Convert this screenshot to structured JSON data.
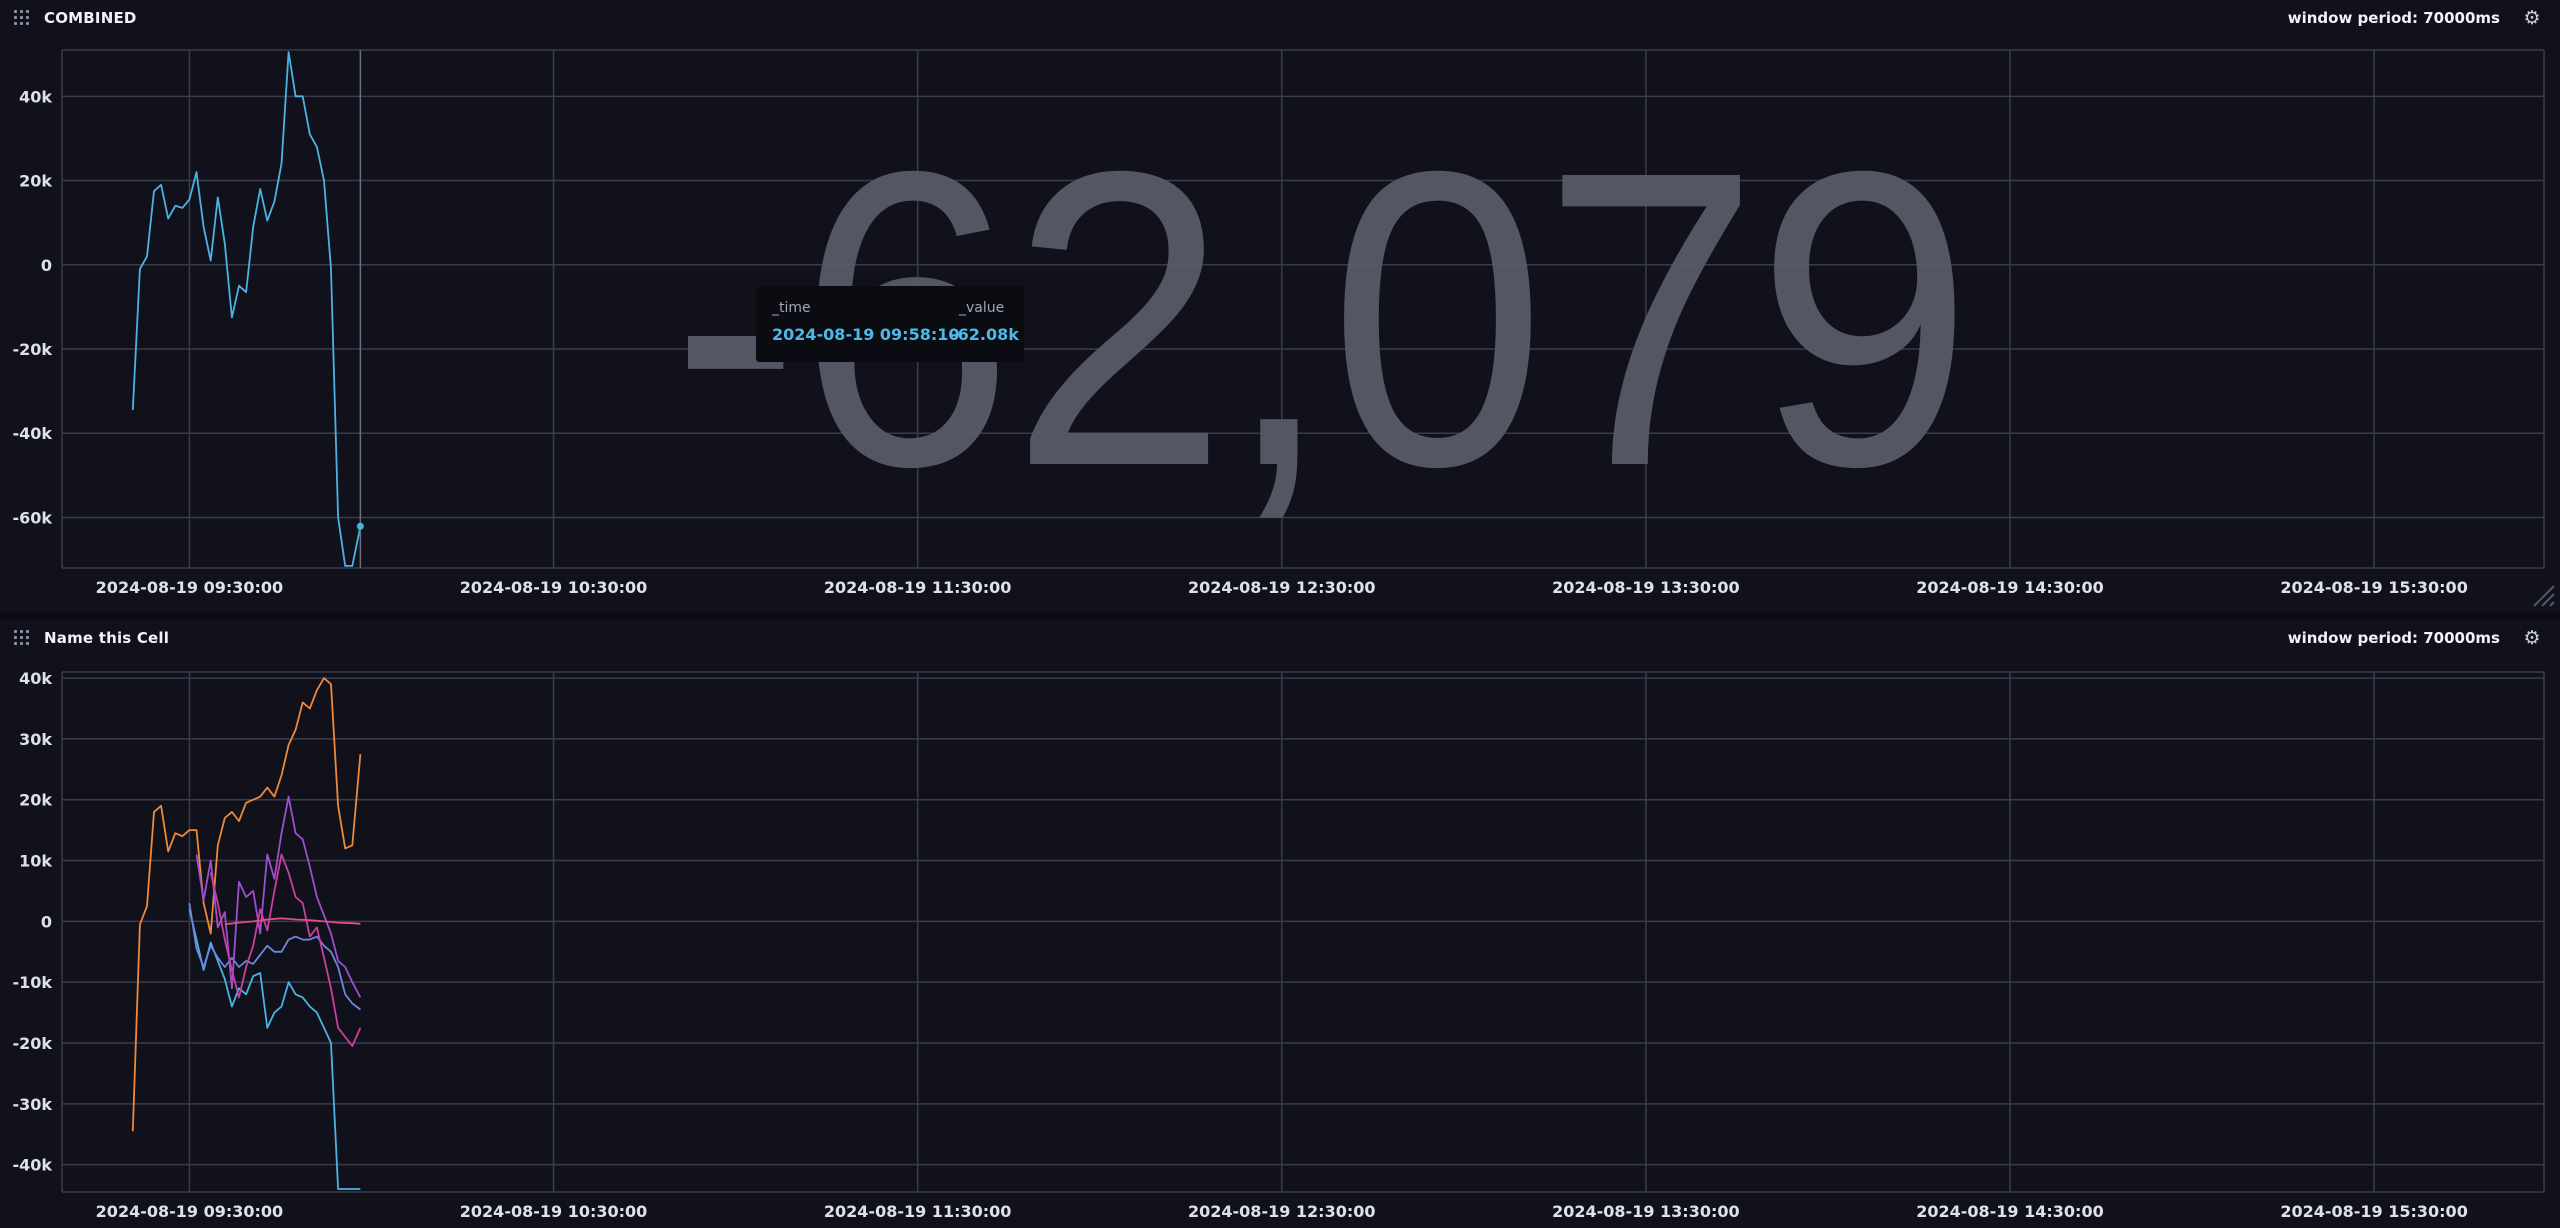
{
  "cells": [
    {
      "title": "COMBINED",
      "window_period": "window period: 70000ms",
      "big_value": "-62,079",
      "tooltip": {
        "time_header": "_time",
        "value_header": "_value",
        "time": "2024-08-19 09:58:10",
        "value": "-62.08k"
      }
    },
    {
      "title": "Name this Cell",
      "window_period": "window period: 70000ms"
    }
  ],
  "colors": {
    "background": "#10111b",
    "grid": "#3a3c4c",
    "big_value": "#5a5c6a",
    "series_blue": "#4ab3e4",
    "series_orange": "#f0883a",
    "series_purple": "#9e4fcf",
    "series_magenta": "#c8409c",
    "series_pink": "#e0507a",
    "series_indigo": "#6d86e0"
  },
  "chart_data": [
    {
      "type": "line",
      "title": "COMBINED",
      "xlabel": "",
      "ylabel": "",
      "x_ticks": [
        "2024-08-19 09:30:00",
        "2024-08-19 10:30:00",
        "2024-08-19 11:30:00",
        "2024-08-19 12:30:00",
        "2024-08-19 13:30:00",
        "2024-08-19 14:30:00",
        "2024-08-19 15:30:00"
      ],
      "y_ticks": [
        "40k",
        "20k",
        "0",
        "-20k",
        "-40k",
        "-60k"
      ],
      "xlim": [
        "2024-08-19 09:09:00",
        "2024-08-19 15:58:00"
      ],
      "ylim": [
        -72000,
        51000
      ],
      "grid": true,
      "series": [
        {
          "color": "#4ab3e4",
          "x": [
            "2024-08-19 09:20:40",
            "2024-08-19 09:21:50",
            "2024-08-19 09:23:00",
            "2024-08-19 09:24:10",
            "2024-08-19 09:25:20",
            "2024-08-19 09:26:30",
            "2024-08-19 09:27:40",
            "2024-08-19 09:28:50",
            "2024-08-19 09:30:00",
            "2024-08-19 09:31:10",
            "2024-08-19 09:32:20",
            "2024-08-19 09:33:30",
            "2024-08-19 09:34:40",
            "2024-08-19 09:35:50",
            "2024-08-19 09:37:00",
            "2024-08-19 09:38:10",
            "2024-08-19 09:39:20",
            "2024-08-19 09:40:30",
            "2024-08-19 09:41:40",
            "2024-08-19 09:42:50",
            "2024-08-19 09:44:00",
            "2024-08-19 09:45:10",
            "2024-08-19 09:46:20",
            "2024-08-19 09:47:30",
            "2024-08-19 09:48:40",
            "2024-08-19 09:49:50",
            "2024-08-19 09:51:00",
            "2024-08-19 09:52:10",
            "2024-08-19 09:53:20",
            "2024-08-19 09:54:30",
            "2024-08-19 09:55:40",
            "2024-08-19 09:56:50",
            "2024-08-19 09:58:10"
          ],
          "values": [
            -34500,
            -1000,
            2000,
            17500,
            19000,
            11000,
            14000,
            13500,
            15500,
            22000,
            9000,
            1000,
            16000,
            5000,
            -12500,
            -5000,
            -6500,
            9000,
            18000,
            10500,
            15000,
            24000,
            50500,
            40000,
            40000,
            31000,
            28000,
            20000,
            -1000,
            -60000,
            -71500,
            -71500,
            -62079
          ]
        }
      ]
    },
    {
      "type": "line",
      "title": "Name this Cell",
      "xlabel": "",
      "ylabel": "",
      "x_ticks": [
        "2024-08-19 09:30:00",
        "2024-08-19 10:30:00",
        "2024-08-19 11:30:00",
        "2024-08-19 12:30:00",
        "2024-08-19 13:30:00",
        "2024-08-19 14:30:00",
        "2024-08-19 15:30:00"
      ],
      "y_ticks": [
        "40k",
        "30k",
        "20k",
        "10k",
        "0",
        "-10k",
        "-20k",
        "-30k",
        "-40k"
      ],
      "xlim": [
        "2024-08-19 09:09:00",
        "2024-08-19 15:58:00"
      ],
      "ylim": [
        -44500,
        41000
      ],
      "grid": true,
      "series": [
        {
          "color": "#f0883a",
          "x": [
            "2024-08-19 09:20:40",
            "2024-08-19 09:21:50",
            "2024-08-19 09:23:00",
            "2024-08-19 09:24:10",
            "2024-08-19 09:25:20",
            "2024-08-19 09:26:30",
            "2024-08-19 09:27:40",
            "2024-08-19 09:28:50",
            "2024-08-19 09:30:00",
            "2024-08-19 09:31:10",
            "2024-08-19 09:32:20",
            "2024-08-19 09:33:30",
            "2024-08-19 09:34:40",
            "2024-08-19 09:35:50",
            "2024-08-19 09:37:00",
            "2024-08-19 09:38:10",
            "2024-08-19 09:39:20",
            "2024-08-19 09:40:30",
            "2024-08-19 09:41:40",
            "2024-08-19 09:42:50",
            "2024-08-19 09:44:00",
            "2024-08-19 09:45:10",
            "2024-08-19 09:46:20",
            "2024-08-19 09:47:30",
            "2024-08-19 09:48:40",
            "2024-08-19 09:49:50",
            "2024-08-19 09:51:00",
            "2024-08-19 09:52:10",
            "2024-08-19 09:53:20",
            "2024-08-19 09:54:30",
            "2024-08-19 09:55:40",
            "2024-08-19 09:56:50",
            "2024-08-19 09:58:10"
          ],
          "values": [
            -34500,
            -500,
            2500,
            18000,
            19000,
            11500,
            14500,
            14000,
            15000,
            15000,
            3000,
            -2000,
            12500,
            17000,
            18000,
            16500,
            19500,
            20000,
            20500,
            22000,
            20500,
            24000,
            29000,
            31500,
            36000,
            35000,
            38000,
            40000,
            39000,
            19000,
            12000,
            12500,
            27500
          ]
        },
        {
          "color": "#4ab3e4",
          "x": [
            "2024-08-19 09:30:00",
            "2024-08-19 09:31:10",
            "2024-08-19 09:32:20",
            "2024-08-19 09:33:30",
            "2024-08-19 09:34:40",
            "2024-08-19 09:35:50",
            "2024-08-19 09:37:00",
            "2024-08-19 09:38:10",
            "2024-08-19 09:39:20",
            "2024-08-19 09:40:30",
            "2024-08-19 09:41:40",
            "2024-08-19 09:42:50",
            "2024-08-19 09:44:00",
            "2024-08-19 09:45:10",
            "2024-08-19 09:46:20",
            "2024-08-19 09:47:30",
            "2024-08-19 09:48:40",
            "2024-08-19 09:49:50",
            "2024-08-19 09:51:00",
            "2024-08-19 09:52:10",
            "2024-08-19 09:53:20",
            "2024-08-19 09:54:30",
            "2024-08-19 09:55:40",
            "2024-08-19 09:56:50",
            "2024-08-19 09:58:10"
          ],
          "values": [
            2000,
            -3000,
            -8000,
            -3500,
            -6500,
            -9500,
            -14000,
            -11000,
            -12000,
            -9000,
            -8500,
            -17500,
            -15000,
            -14000,
            -10000,
            -12000,
            -12500,
            -14000,
            -15000,
            -17500,
            -20000,
            -44000,
            -44000,
            -44000,
            -44000
          ]
        },
        {
          "color": "#6d86e0",
          "x": [
            "2024-08-19 09:30:00",
            "2024-08-19 09:31:10",
            "2024-08-19 09:32:20",
            "2024-08-19 09:33:30",
            "2024-08-19 09:34:40",
            "2024-08-19 09:35:50",
            "2024-08-19 09:37:00",
            "2024-08-19 09:38:10",
            "2024-08-19 09:39:20",
            "2024-08-19 09:40:30",
            "2024-08-19 09:41:40",
            "2024-08-19 09:42:50",
            "2024-08-19 09:44:00",
            "2024-08-19 09:45:10",
            "2024-08-19 09:46:20",
            "2024-08-19 09:47:30",
            "2024-08-19 09:48:40",
            "2024-08-19 09:49:50",
            "2024-08-19 09:51:00",
            "2024-08-19 09:52:10",
            "2024-08-19 09:53:20",
            "2024-08-19 09:54:30",
            "2024-08-19 09:55:40",
            "2024-08-19 09:56:50",
            "2024-08-19 09:58:10"
          ],
          "values": [
            3000,
            -4500,
            -7500,
            -4000,
            -6000,
            -7500,
            -6000,
            -7500,
            -6500,
            -7000,
            -5500,
            -4000,
            -5000,
            -5000,
            -3000,
            -2500,
            -3000,
            -3000,
            -2500,
            -4000,
            -5000,
            -7500,
            -12000,
            -13500,
            -14500
          ]
        },
        {
          "color": "#9e4fcf",
          "x": [
            "2024-08-19 09:31:10",
            "2024-08-19 09:32:20",
            "2024-08-19 09:33:30",
            "2024-08-19 09:34:40",
            "2024-08-19 09:35:50",
            "2024-08-19 09:37:00",
            "2024-08-19 09:38:10",
            "2024-08-19 09:39:20",
            "2024-08-19 09:40:30",
            "2024-08-19 09:41:40",
            "2024-08-19 09:42:50",
            "2024-08-19 09:44:00",
            "2024-08-19 09:45:10",
            "2024-08-19 09:46:20",
            "2024-08-19 09:47:30",
            "2024-08-19 09:48:40",
            "2024-08-19 09:49:50",
            "2024-08-19 09:51:00",
            "2024-08-19 09:52:10",
            "2024-08-19 09:53:20",
            "2024-08-19 09:54:30",
            "2024-08-19 09:55:40",
            "2024-08-19 09:56:50",
            "2024-08-19 09:58:10"
          ],
          "values": [
            11000,
            3500,
            10000,
            -1000,
            1500,
            -11000,
            6500,
            4000,
            5000,
            -2000,
            11000,
            7000,
            14500,
            20500,
            14500,
            13500,
            9000,
            4000,
            1000,
            -2000,
            -6500,
            -7500,
            -10000,
            -12500
          ]
        },
        {
          "color": "#c8409c",
          "x": [
            "2024-08-19 09:33:30",
            "2024-08-19 09:34:40",
            "2024-08-19 09:35:50",
            "2024-08-19 09:37:00",
            "2024-08-19 09:38:10",
            "2024-08-19 09:39:20",
            "2024-08-19 09:40:30",
            "2024-08-19 09:41:40",
            "2024-08-19 09:42:50",
            "2024-08-19 09:44:00",
            "2024-08-19 09:45:10",
            "2024-08-19 09:46:20",
            "2024-08-19 09:47:30",
            "2024-08-19 09:48:40",
            "2024-08-19 09:49:50",
            "2024-08-19 09:51:00",
            "2024-08-19 09:52:10",
            "2024-08-19 09:53:20",
            "2024-08-19 09:54:30",
            "2024-08-19 09:55:40",
            "2024-08-19 09:56:50",
            "2024-08-19 09:58:10"
          ],
          "values": [
            8000,
            3000,
            -3000,
            -8000,
            -12500,
            -7500,
            -4000,
            2000,
            -1500,
            5000,
            11000,
            8000,
            4000,
            3000,
            -2500,
            -1000,
            -6000,
            -11000,
            -17500,
            -19000,
            -20500,
            -17500
          ]
        },
        {
          "color": "#e0507a",
          "x": [
            "2024-08-19 09:35:50",
            "2024-08-19 09:38:10",
            "2024-08-19 09:40:30",
            "2024-08-19 09:42:50",
            "2024-08-19 09:45:10",
            "2024-08-19 09:47:30",
            "2024-08-19 09:49:50",
            "2024-08-19 09:52:10",
            "2024-08-19 09:54:30",
            "2024-08-19 09:56:50",
            "2024-08-19 09:58:10"
          ],
          "values": [
            -500,
            -200,
            0,
            300,
            500,
            300,
            200,
            0,
            -200,
            -300,
            -400
          ]
        }
      ]
    }
  ]
}
